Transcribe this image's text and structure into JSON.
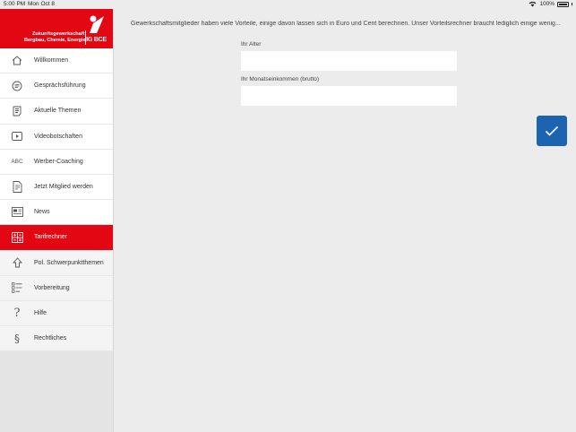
{
  "statusbar": {
    "time": "5:00 PM",
    "date": "Mon Oct 8",
    "battery": "100%"
  },
  "brand": {
    "line1": "Zukunftsgewerkschaft",
    "line2": "Bergbau, Chemie, Energie",
    "logo": "IG BCE"
  },
  "menu": {
    "items": [
      {
        "label": "Willkommen",
        "icon": "home-icon"
      },
      {
        "label": "Gesprächsführung",
        "icon": "chat-icon"
      },
      {
        "label": "Aktuelle Themen",
        "icon": "scroll-icon"
      },
      {
        "label": "Videobotschaften",
        "icon": "play-icon"
      },
      {
        "label": "Werber-Coaching",
        "icon": "abc-icon",
        "icon_text": "ABC"
      },
      {
        "label": "Jetzt Mitglied werden",
        "icon": "form-icon"
      },
      {
        "label": "News",
        "icon": "newspaper-icon"
      },
      {
        "label": "Tarifrechner",
        "icon": "calculator-icon",
        "active": true
      },
      {
        "label": "Pol. Schwerpunktthemen",
        "icon": "arrow-up-icon"
      },
      {
        "label": "Vorbereitung",
        "icon": "checklist-icon"
      },
      {
        "label": "Hilfe",
        "icon": "question-icon",
        "icon_text": "?"
      },
      {
        "label": "Rechtliches",
        "icon": "paragraph-icon",
        "icon_text": "§"
      }
    ]
  },
  "main": {
    "intro": "Gewerkschaftsmitglieder haben viele Vorteile, einige davon lassen sich in Euro und Cent berechnen. Unser Vorteilsrechner braucht lediglich einige wenig...",
    "age_label": "Ihr Alter",
    "age_value": "",
    "income_label": "Ihr Monatseinkommen (brutto)",
    "income_value": ""
  },
  "colors": {
    "brand_red": "#e30613",
    "button_blue": "#1c64b0"
  }
}
